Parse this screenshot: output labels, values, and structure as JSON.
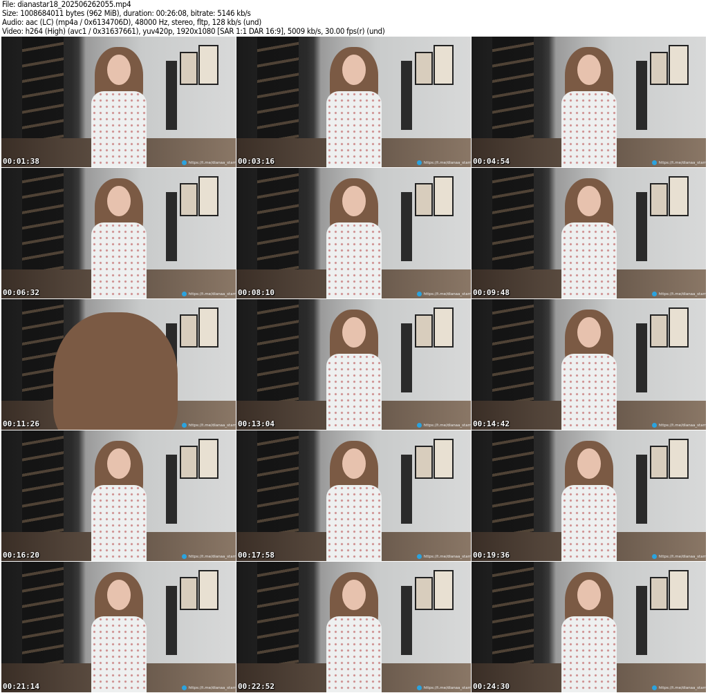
{
  "header": {
    "file": "File: dianastar18_202506262055.mp4",
    "size": "Size: 1008684011 bytes (962 MiB), duration: 00:26:08, bitrate: 5146 kb/s",
    "audio": "Audio: aac (LC) (mp4a / 0x6134706D), 48000 Hz, stereo, fltp, 128 kb/s (und)",
    "video": "Video: h264 (High) (avc1 / 0x31637661), yuv420p, 1920x1080 [SAR 1:1 DAR 16:9], 5009 kb/s, 30.00 fps(r) (und)"
  },
  "watermark": "https://t.me/dianaa_starr",
  "thumbnails": [
    {
      "time": "00:01:38"
    },
    {
      "time": "00:03:16"
    },
    {
      "time": "00:04:54"
    },
    {
      "time": "00:06:32"
    },
    {
      "time": "00:08:10"
    },
    {
      "time": "00:09:48"
    },
    {
      "time": "00:11:26"
    },
    {
      "time": "00:13:04"
    },
    {
      "time": "00:14:42"
    },
    {
      "time": "00:16:20"
    },
    {
      "time": "00:17:58"
    },
    {
      "time": "00:19:36"
    },
    {
      "time": "00:21:14"
    },
    {
      "time": "00:22:52"
    },
    {
      "time": "00:24:30"
    }
  ]
}
